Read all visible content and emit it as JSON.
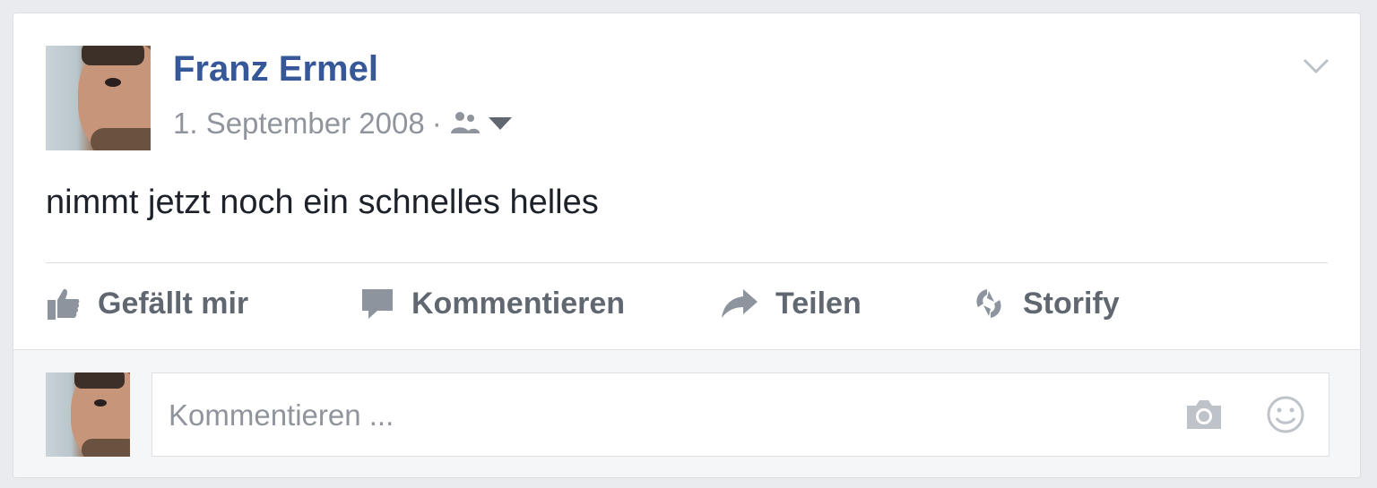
{
  "post": {
    "author": "Franz Ermel",
    "date": "1. September 2008",
    "separator": "·",
    "text": "nimmt jetzt noch ein schnelles helles"
  },
  "actions": {
    "like": "Gefällt mir",
    "comment": "Kommentieren",
    "share": "Teilen",
    "storify": "Storify"
  },
  "comment_box": {
    "placeholder": "Kommentieren ..."
  },
  "icons": {
    "audience": "friends-icon",
    "menu": "chevron-down-icon",
    "like": "thumbs-up-icon",
    "comment": "speech-bubble-icon",
    "share": "share-arrow-icon",
    "storify": "storify-icon",
    "photo": "camera-icon",
    "emoji": "smiley-icon"
  },
  "colors": {
    "author_link": "#365899",
    "meta_gray": "#90949c",
    "action_gray": "#606770",
    "background": "#e9ebee"
  }
}
